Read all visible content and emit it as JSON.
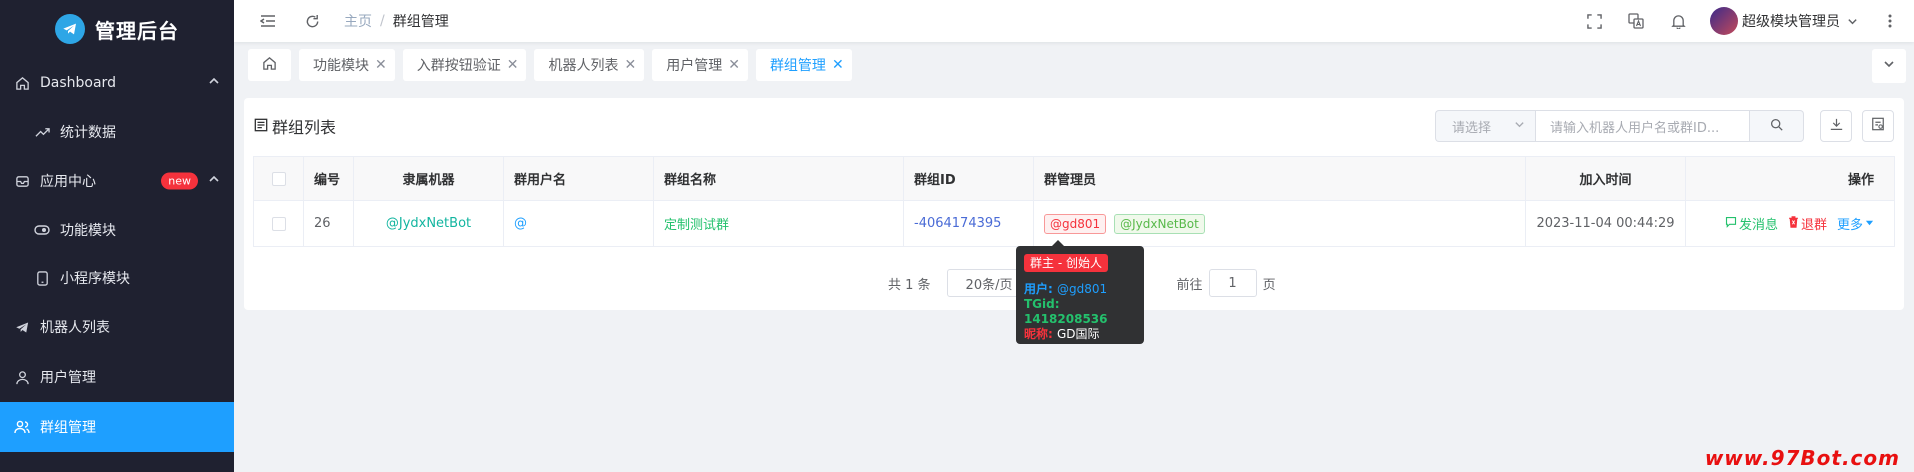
{
  "sidebar": {
    "logo_text": "管理后台",
    "items": [
      {
        "label": "Dashboard",
        "icon": "home-icon"
      },
      {
        "label": "统计数据",
        "icon": "trend-icon"
      },
      {
        "label": "应用中心",
        "icon": "inbox-icon",
        "badge": "new"
      },
      {
        "label": "功能模块",
        "icon": "toggle-icon"
      },
      {
        "label": "小程序模块",
        "icon": "mobile-icon"
      },
      {
        "label": "机器人列表",
        "icon": "telegram-icon"
      },
      {
        "label": "用户管理",
        "icon": "user-icon"
      },
      {
        "label": "群组管理",
        "icon": "users-icon"
      }
    ]
  },
  "header": {
    "breadcrumb": {
      "home": "主页",
      "separator": "/",
      "current": "群组管理"
    },
    "username": "超级模块管理员"
  },
  "tabs": [
    {
      "label": "功能模块"
    },
    {
      "label": "入群按钮验证"
    },
    {
      "label": "机器人列表"
    },
    {
      "label": "用户管理"
    },
    {
      "label": "群组管理",
      "active": true
    }
  ],
  "card": {
    "title": "群组列表",
    "select_placeholder": "请选择",
    "search_placeholder": "请输入机器人用户名或群ID..."
  },
  "table": {
    "columns": [
      "编号",
      "隶属机器",
      "群用户名",
      "群组名称",
      "群组ID",
      "群管理员",
      "加入时间",
      "操作"
    ],
    "rows": [
      {
        "id": "26",
        "bot": "@JydxNetBot",
        "username": "@",
        "name": "定制测试群",
        "group_id": "-4064174395",
        "admins": [
          "@gd801",
          "@JydxNetBot"
        ],
        "joined": "2023-11-04 00:44:29",
        "ops": {
          "send": "发消息",
          "leave": "退群",
          "more": "更多"
        }
      }
    ]
  },
  "pagination": {
    "total": "共 1 条",
    "page_size": "20条/页",
    "goto_prefix": "前往",
    "goto_value": "1",
    "goto_suffix": "页"
  },
  "tooltip": {
    "badge": "群主 - 创始人",
    "user_label": "用户:",
    "user_value": "@gd801",
    "tgid_label": "TGid:",
    "tgid_value": "1418208536",
    "nick_label": "昵称:",
    "nick_value": "GD国际"
  },
  "watermark": "www.97Bot.com",
  "colors": {
    "primary": "#1e9fff",
    "sidebar_bg": "#1f2130",
    "teal": "#13b5a0",
    "danger": "#f5323c",
    "success": "#24c16d"
  }
}
